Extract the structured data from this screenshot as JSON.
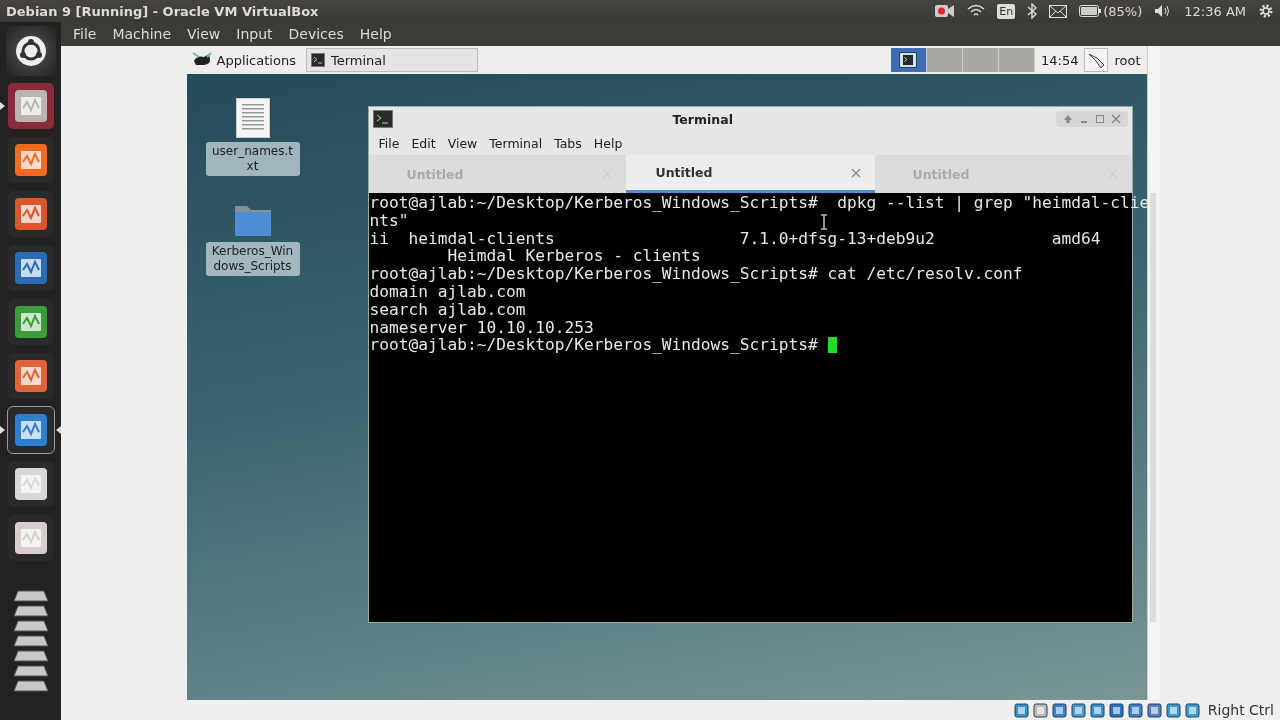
{
  "window": {
    "title": "Debian 9 [Running] - Oracle VM VirtualBox"
  },
  "tray": {
    "keyboard": "En",
    "battery": "(85%)",
    "clock": "12:36 AM"
  },
  "launcher": [
    {
      "running": true,
      "focused": false
    },
    {
      "running": false,
      "focused": false
    },
    {
      "running": false,
      "focused": false
    },
    {
      "running": false,
      "focused": false
    },
    {
      "running": false,
      "focused": false
    },
    {
      "running": false,
      "focused": false
    },
    {
      "running": true,
      "focused": true
    },
    {
      "running": false,
      "focused": false
    },
    {
      "running": false,
      "focused": false
    }
  ],
  "vbox_menu": [
    "File",
    "Machine",
    "View",
    "Input",
    "Devices",
    "Help"
  ],
  "guest_panel": {
    "applications": "Applications",
    "task": "Terminal",
    "workspaces": [
      {
        "selected": true
      },
      {
        "selected": false
      },
      {
        "selected": false
      },
      {
        "selected": false
      }
    ],
    "clock": "14:54",
    "user": "root"
  },
  "desktop_icons": [
    {
      "kind": "file",
      "label": "user_names.txt"
    },
    {
      "kind": "folder",
      "label": "Kerberos_Windows_Scripts"
    }
  ],
  "terminal": {
    "title": "Terminal",
    "menu": [
      "File",
      "Edit",
      "View",
      "Terminal",
      "Tabs",
      "Help"
    ],
    "tabs": [
      {
        "label": "Untitled",
        "selected": false
      },
      {
        "label": "Untitled",
        "selected": true
      },
      {
        "label": "Untitled",
        "selected": false
      }
    ],
    "lines": [
      "root@ajlab:~/Desktop/Kerberos_Windows_Scripts#  dpkg --list | grep \"heimdal-clie",
      "nts\"",
      "ii  heimdal-clients                   7.1.0+dfsg-13+deb9u2            amd64",
      "        Heimdal Kerberos - clients",
      "root@ajlab:~/Desktop/Kerberos_Windows_Scripts# cat /etc/resolv.conf",
      "domain ajlab.com",
      "search ajlab.com",
      "nameserver 10.10.10.253",
      "root@ajlab:~/Desktop/Kerberos_Windows_Scripts# "
    ]
  },
  "status_bar": {
    "host_key": "Right Ctrl"
  }
}
